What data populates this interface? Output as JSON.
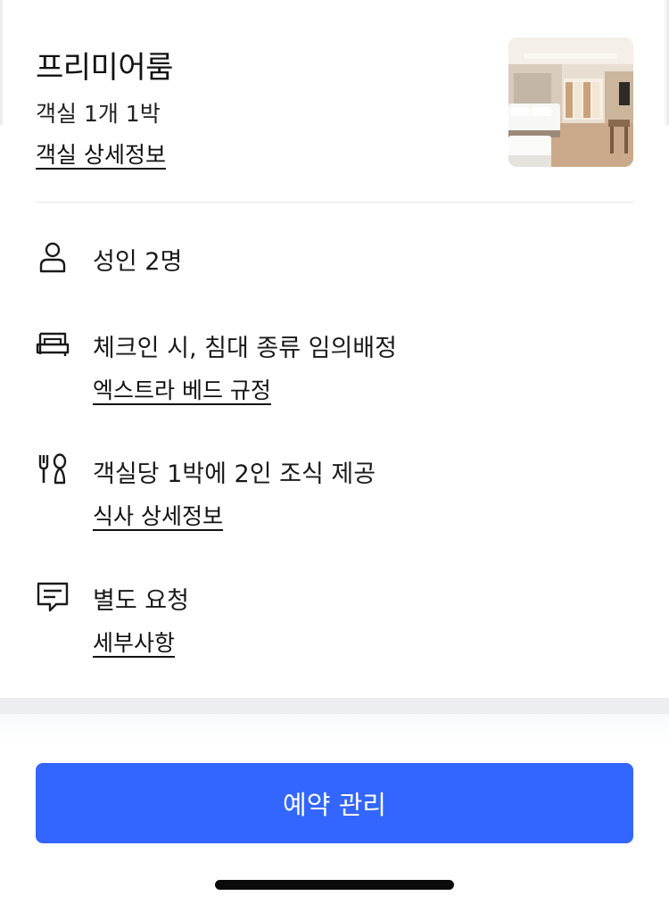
{
  "room": {
    "name": "프리미어룸",
    "summary": "객실 1개 1박",
    "details_link": "객실 상세정보",
    "photo_icon": "hotel-room-photo"
  },
  "details": {
    "guests": {
      "icon": "person-icon",
      "text": "성인 2명"
    },
    "bed": {
      "icon": "bed-icon",
      "text": "체크인 시, 침대 종류 임의배정",
      "link": "엑스트라 베드 규정"
    },
    "meal": {
      "icon": "utensils-icon",
      "text": "객실당 1박에 2인 조식 제공",
      "link": "식사 상세정보"
    },
    "request": {
      "icon": "message-icon",
      "text": "별도 요청",
      "link": "세부사항"
    }
  },
  "footer": {
    "manage_button": "예약 관리",
    "accent_color": "#3366ff"
  }
}
